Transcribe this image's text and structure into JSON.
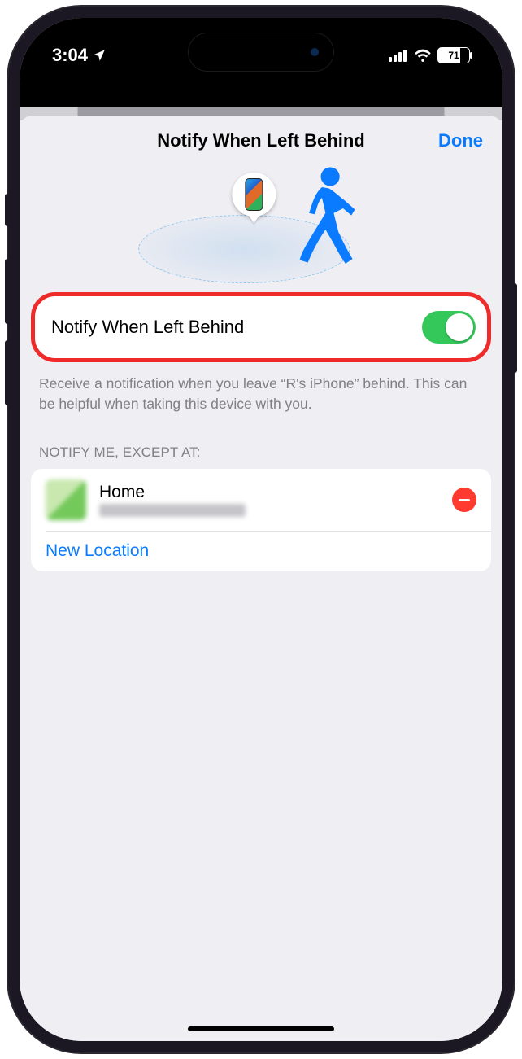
{
  "status": {
    "time": "3:04",
    "battery_percent": "71"
  },
  "nav": {
    "title": "Notify When Left Behind",
    "done": "Done"
  },
  "toggle": {
    "label": "Notify When Left Behind",
    "on": true
  },
  "help_text": "Receive a notification when you leave “R's iPhone” behind. This can be helpful when taking this device with you.",
  "section_header": "NOTIFY ME, EXCEPT AT:",
  "locations": [
    {
      "title": "Home"
    }
  ],
  "new_location_label": "New Location"
}
